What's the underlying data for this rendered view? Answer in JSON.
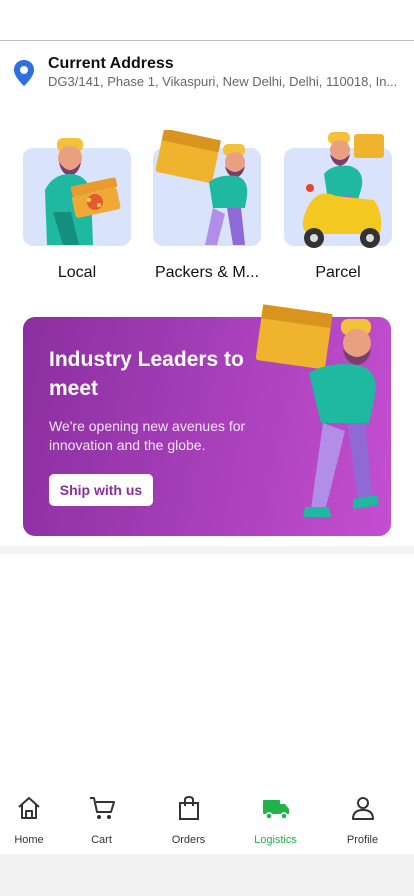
{
  "address": {
    "title": "Current Address",
    "line": "DG3/141, Phase 1, Vikaspuri, New Delhi, Delhi, 110018, In..."
  },
  "services": [
    {
      "label": "Local",
      "icon": "pizza-delivery-illustration"
    },
    {
      "label": "Packers & M...",
      "icon": "box-carrier-illustration"
    },
    {
      "label": "Parcel",
      "icon": "scooter-delivery-illustration"
    }
  ],
  "banner": {
    "title": "Industry Leaders to meet",
    "subtitle": "We're opening new avenues for innovation and the globe.",
    "button": "Ship with us"
  },
  "nav": {
    "items": [
      {
        "label": "Home",
        "icon": "home-icon"
      },
      {
        "label": "Cart",
        "icon": "cart-icon"
      },
      {
        "label": "Orders",
        "icon": "bag-icon"
      },
      {
        "label": "Logistics",
        "icon": "truck-icon",
        "active": true
      },
      {
        "label": "Profile",
        "icon": "user-icon"
      }
    ]
  },
  "colors": {
    "accent_green": "#22b24c",
    "banner_purple": "#a63fb8",
    "pin_blue": "#2f6fe0",
    "card_blue": "#d9e3fb"
  }
}
